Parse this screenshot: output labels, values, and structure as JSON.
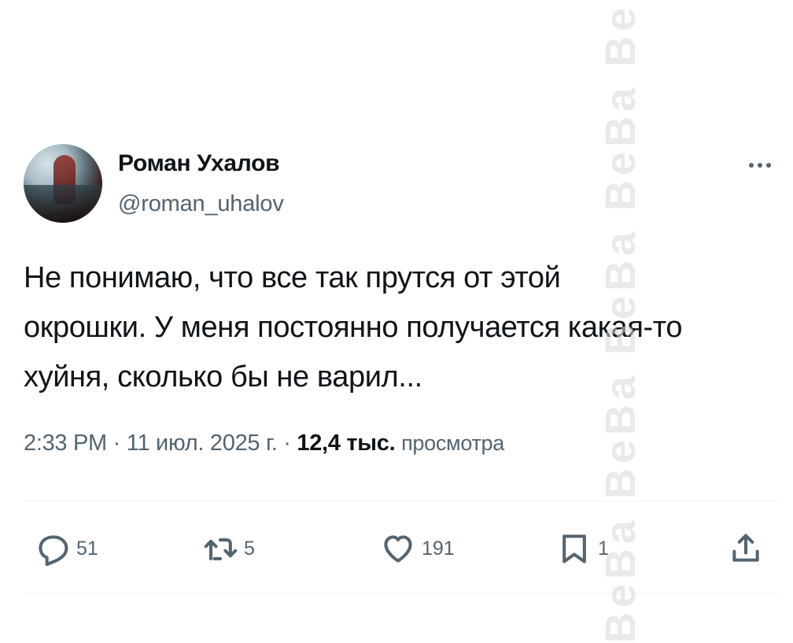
{
  "author": {
    "display_name": "Роман Ухалов",
    "handle": "@roman_uhalov"
  },
  "tweet": {
    "text": "Не понимаю, что все так прутся от этой\nокрошки. У меня постоянно получается какая-то\nхуйня, сколько бы не варил...",
    "time": "2:33 PM",
    "date": "11 июл. 2025 г.",
    "separator": "·",
    "views_count": "12,4 тыс.",
    "views_label": "просмотра"
  },
  "actions": {
    "replies": "51",
    "retweets": "5",
    "likes": "191",
    "bookmarks": "1"
  },
  "watermark": {
    "text": "BeBa BeBa BeBa BeBa BeBa BeBa BeBa"
  },
  "colors": {
    "text_primary": "#0f1419",
    "text_secondary": "#536471",
    "divider": "#eff3f4"
  },
  "icons": {
    "more": "more-horizontal-icon",
    "reply": "reply-icon",
    "retweet": "retweet-icon",
    "like": "heart-icon",
    "bookmark": "bookmark-icon",
    "share": "share-icon"
  }
}
